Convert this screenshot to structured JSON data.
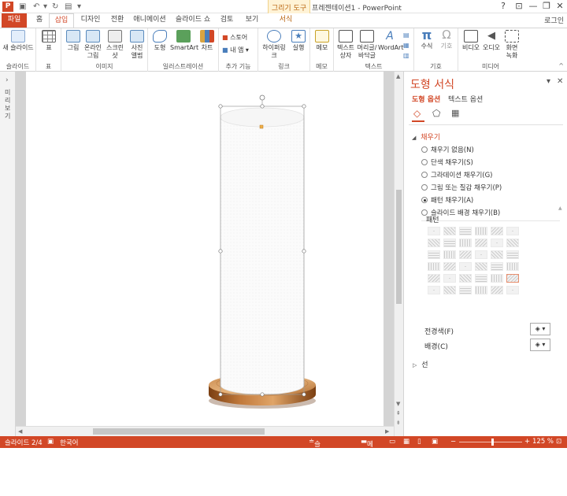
{
  "titlebar": {
    "logo": "P",
    "context_group": "그리기 도구",
    "app_title": "프레젠테이션1 - PowerPoint",
    "help": "?",
    "minimize": "—",
    "restore": "❐",
    "close": "✕"
  },
  "tabs": {
    "file": "파일",
    "home": "홈",
    "insert": "삽입",
    "design": "디자인",
    "transitions": "전환",
    "animations": "애니메이션",
    "slideshow": "슬라이드 쇼",
    "review": "검토",
    "view": "보기",
    "format": "서식",
    "login": "로그인"
  },
  "ribbon": {
    "slides": {
      "new_slide": "새 슬라이드",
      "label": "슬라이드"
    },
    "tables": {
      "table": "표",
      "label": "표"
    },
    "images": {
      "picture": "그림",
      "online_picture": "온라인 그림",
      "screenshot": "스크린샷",
      "album": "사진 앨범",
      "label": "이미지"
    },
    "illustrations": {
      "shapes": "도형",
      "smartart": "SmartArt",
      "chart": "차트",
      "label": "일러스트레이션"
    },
    "addins": {
      "store": "스토어",
      "my_addins": "내 앱",
      "label": "추가 기능"
    },
    "links": {
      "hyperlink": "하이퍼링크",
      "action": "실행",
      "label": "링크"
    },
    "comments": {
      "comment": "메모",
      "label": "메모"
    },
    "text": {
      "textbox": "텍스트 상자",
      "header_footer": "머리글/바닥글",
      "wordart": "WordArt",
      "label": "텍스트"
    },
    "symbols": {
      "equation": "수식",
      "symbol": "기호",
      "label": "기호"
    },
    "media": {
      "video": "비디오",
      "audio": "오디오",
      "screen_recording": "화면 녹화",
      "label": "미디어"
    }
  },
  "left_panel": {
    "label": "미리 보기"
  },
  "format_pane": {
    "title": "도형 서식",
    "tab_shape": "도형 옵션",
    "tab_text": "텍스트 옵션",
    "fill_header": "채우기",
    "fill_options": [
      {
        "label": "채우기 없음(N)",
        "selected": false
      },
      {
        "label": "단색 채우기(S)",
        "selected": false
      },
      {
        "label": "그라데이션 채우기(G)",
        "selected": false
      },
      {
        "label": "그림 또는 질감 채우기(P)",
        "selected": false
      },
      {
        "label": "패턴 채우기(A)",
        "selected": true
      },
      {
        "label": "슬라이드 배경 채우기(B)",
        "selected": false
      }
    ],
    "pattern_label": "패턴",
    "foreground_label": "전경색(F)",
    "background_label": "배경(C)",
    "line_header": "선"
  },
  "statusbar": {
    "slide": "슬라이드 2/4",
    "language": "한국어",
    "notes": "슬라이드 노트",
    "comments": "메모",
    "zoom": "125 %"
  },
  "colors": {
    "accent": "#d24726"
  }
}
